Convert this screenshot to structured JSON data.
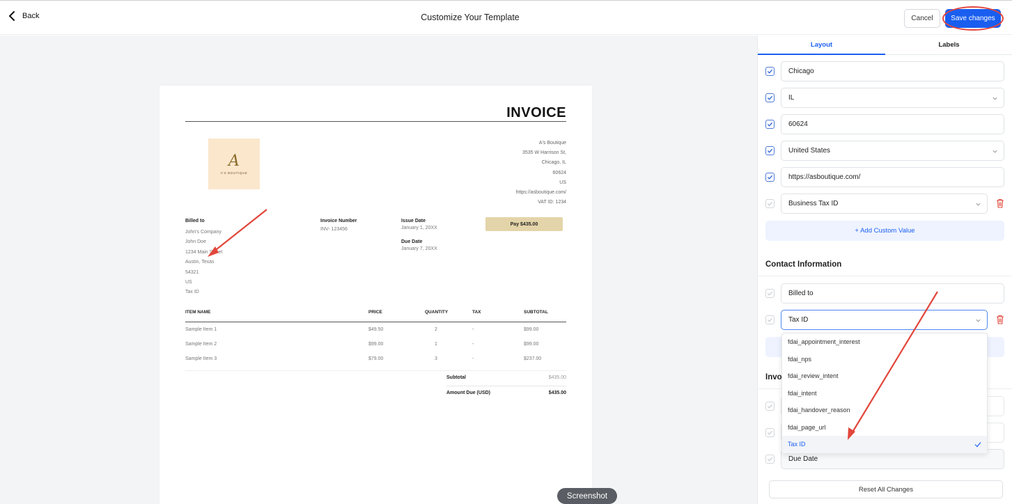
{
  "header": {
    "back_label": "Back",
    "title": "Customize Your Template",
    "cancel_label": "Cancel",
    "save_label": "Save changes"
  },
  "invoice": {
    "title": "INVOICE",
    "logo": {
      "mark": "A",
      "text": "A'S BOUTIQUE"
    },
    "company": [
      "A's Boutique",
      "3535 W Harrison St,",
      "Chicago, IL",
      "60624",
      "US",
      "https://asboutique.com/",
      "VAT ID: 1234"
    ],
    "billed_to": {
      "label": "Billed to",
      "lines": [
        "John's Company",
        "John Doe",
        "1234 Main Street",
        "Austin, Texas",
        "54321",
        "US",
        "Tax ID"
      ]
    },
    "invoice_number": {
      "label": "Invoice Number",
      "value": "INV- 123456"
    },
    "issue_date": {
      "label": "Issue Date",
      "value": "January 1, 20XX"
    },
    "due_date": {
      "label": "Due Date",
      "value": "January 7, 20XX"
    },
    "pay_button": "Pay $435.00",
    "columns": [
      "ITEM NAME",
      "PRICE",
      "QUANTITY",
      "TAX",
      "SUBTOTAL"
    ],
    "items": [
      {
        "name": "Sample Item 1",
        "price": "$49.50",
        "qty": "2",
        "tax": "-",
        "subtotal": "$99.00"
      },
      {
        "name": "Sample Item 2",
        "price": "$99.00",
        "qty": "1",
        "tax": "-",
        "subtotal": "$99.00"
      },
      {
        "name": "Sample Item 3",
        "price": "$79.00",
        "qty": "3",
        "tax": "-",
        "subtotal": "$237.00"
      }
    ],
    "subtotal": {
      "label": "Subtotal",
      "value": "$435.00"
    },
    "amount_due": {
      "label": "Amount Due (USD)",
      "value": "$435.00"
    }
  },
  "panel": {
    "tabs": {
      "layout": "Layout",
      "labels": "Labels"
    },
    "address_fields": {
      "city": "Chicago",
      "state": "IL",
      "zip": "60624",
      "country": "United States",
      "website": "https://asboutique.com/",
      "custom": "Business Tax ID"
    },
    "add_custom_label": "+ Add Custom Value",
    "contact_title": "Contact Information",
    "contact_fields": {
      "billed_to": "Billed to",
      "tax_id": "Tax ID"
    },
    "invoice_section_title": "Invo",
    "due_date_field": "Due Date",
    "dropdown_options": [
      "fdai_appointment_interest",
      "fdai_nps",
      "fdai_review_intent",
      "fdai_intent",
      "fdai_handover_reason",
      "fdai_page_url",
      "Tax ID"
    ],
    "dropdown_selected": "Tax ID",
    "reset_label": "Reset All Changes"
  },
  "screenshot_chip": "Screenshot",
  "colors": {
    "accent": "#1a5ef0",
    "annotation": "#e2463b",
    "pay_button": "#e4d4a9"
  }
}
